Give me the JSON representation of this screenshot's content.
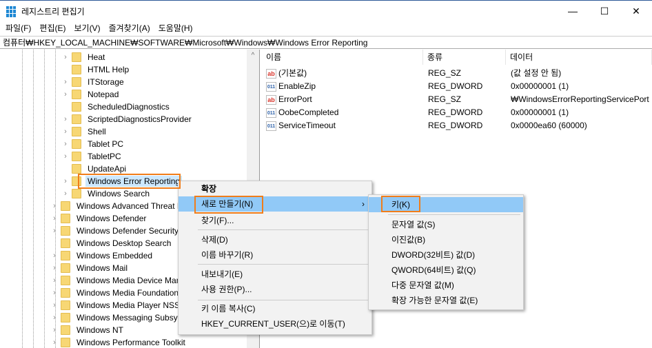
{
  "window": {
    "title": "레지스트리 편집기",
    "minimize": "—",
    "maximize": "☐",
    "close": "✕"
  },
  "menubar": [
    "파일(F)",
    "편집(E)",
    "보기(V)",
    "즐겨찾기(A)",
    "도움말(H)"
  ],
  "address": "컴퓨터₩HKEY_LOCAL_MACHINE₩SOFTWARE₩Microsoft₩Windows₩Windows Error Reporting",
  "tree": {
    "inner": [
      {
        "label": "Heat",
        "exp": true
      },
      {
        "label": "HTML Help",
        "exp": false
      },
      {
        "label": "ITStorage",
        "exp": true
      },
      {
        "label": "Notepad",
        "exp": true
      },
      {
        "label": "ScheduledDiagnostics",
        "exp": false
      },
      {
        "label": "ScriptedDiagnosticsProvider",
        "exp": true
      },
      {
        "label": "Shell",
        "exp": true
      },
      {
        "label": "Tablet PC",
        "exp": true
      },
      {
        "label": "TabletPC",
        "exp": true
      },
      {
        "label": "UpdateApi",
        "exp": false
      },
      {
        "label": "Windows Error Reporting",
        "exp": true,
        "selected": true
      },
      {
        "label": "Windows Search",
        "exp": true
      }
    ],
    "outer": [
      {
        "label": "Windows Advanced Threat P",
        "exp": true
      },
      {
        "label": "Windows Defender",
        "exp": true
      },
      {
        "label": "Windows Defender Security",
        "exp": true
      },
      {
        "label": "Windows Desktop Search",
        "exp": false
      },
      {
        "label": "Windows Embedded",
        "exp": true
      },
      {
        "label": "Windows Mail",
        "exp": true
      },
      {
        "label": "Windows Media Device Man",
        "exp": true
      },
      {
        "label": "Windows Media Foundation",
        "exp": true
      },
      {
        "label": "Windows Media Player NSS",
        "exp": true
      },
      {
        "label": "Windows Messaging Subsys",
        "exp": true
      },
      {
        "label": "Windows NT",
        "exp": true
      },
      {
        "label": "Windows Performance Toolkit",
        "exp": true
      }
    ]
  },
  "list": {
    "headers": [
      "이름",
      "종류",
      "데이터"
    ],
    "rows": [
      {
        "icon": "ab",
        "name": "(기본값)",
        "type": "REG_SZ",
        "data": "(값 설정 안 됨)"
      },
      {
        "icon": "bin",
        "name": "EnableZip",
        "type": "REG_DWORD",
        "data": "0x00000001 (1)"
      },
      {
        "icon": "ab",
        "name": "ErrorPort",
        "type": "REG_SZ",
        "data": "₩WindowsErrorReportingServicePort"
      },
      {
        "icon": "bin",
        "name": "OobeCompleted",
        "type": "REG_DWORD",
        "data": "0x00000001 (1)"
      },
      {
        "icon": "bin",
        "name": "ServiceTimeout",
        "type": "REG_DWORD",
        "data": "0x0000ea60 (60000)"
      }
    ]
  },
  "context_menu": [
    "확장",
    "새로 만들기(N)",
    "찾기(F)...",
    "삭제(D)",
    "이름 바꾸기(R)",
    "내보내기(E)",
    "사용 권한(P)...",
    "키 이름 복사(C)",
    "HKEY_CURRENT_USER(으)로 이동(T)"
  ],
  "submenu": [
    "키(K)",
    "문자열 값(S)",
    "이진값(B)",
    "DWORD(32비트) 값(D)",
    "QWORD(64비트) 값(Q)",
    "다중 문자열 값(M)",
    "확장 가능한 문자열 값(E)"
  ],
  "icons": {
    "ab": "ab",
    "bin": "011",
    "expand": "›",
    "scroll_up": "^",
    "submenu_arrow": "›"
  },
  "colors": {
    "highlight": "#f07d1a",
    "hover": "#91c9f7",
    "selection": "#cce8ff"
  }
}
